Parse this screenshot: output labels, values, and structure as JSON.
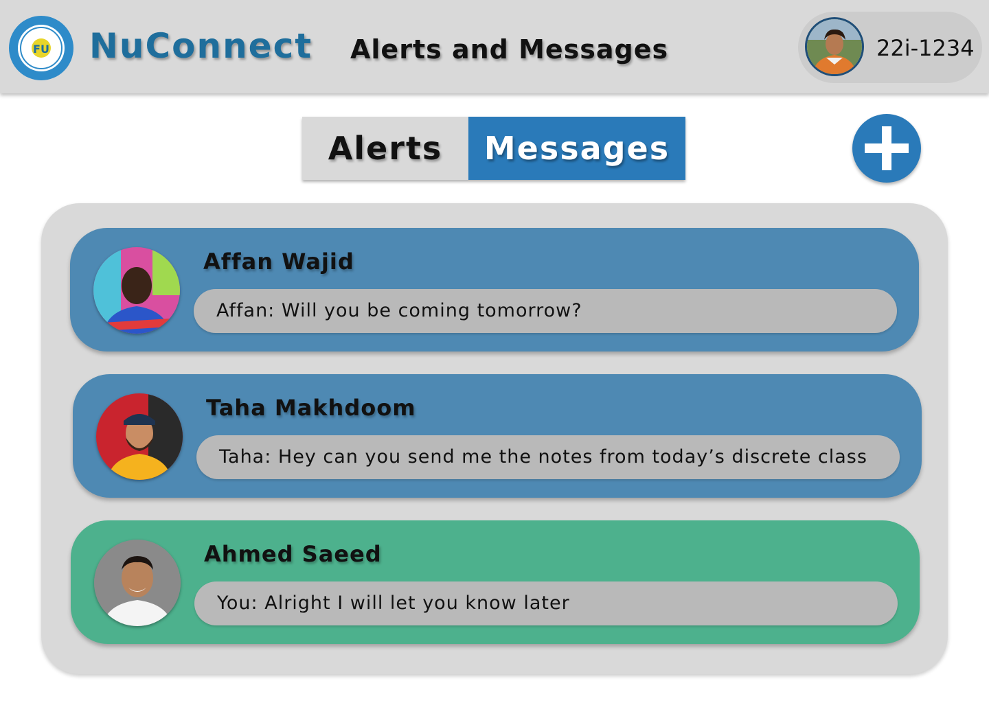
{
  "header": {
    "logo_icon": "nu-university-seal-logo",
    "app_name": "NuConnect",
    "page_title": "Alerts and Messages",
    "user": {
      "id": "22i-1234",
      "avatar_icon": "user-avatar-photo"
    }
  },
  "tabs": [
    {
      "label": "Alerts",
      "active": false
    },
    {
      "label": "Messages",
      "active": true
    }
  ],
  "add_button_icon": "plus-icon",
  "colors": {
    "brand": "#1f6e9c",
    "tab_active": "#2a7ab9",
    "card_blue": "#4e89b3",
    "card_green": "#4db18d",
    "panel": "#d9d9d9",
    "bubble": "#b9b9b9"
  },
  "conversations": [
    {
      "name": "Affan Wajid",
      "preview": "Affan: Will you be coming tomorrow?",
      "color": "blue",
      "avatar_icon": "contact-avatar-photo"
    },
    {
      "name": "Taha Makhdoom",
      "preview": "Taha: Hey can you send me the notes from today’s discrete class",
      "color": "blue",
      "avatar_icon": "contact-avatar-photo"
    },
    {
      "name": "Ahmed Saeed",
      "preview": "You: Alright I will let you know later",
      "color": "green",
      "avatar_icon": "contact-avatar-photo"
    }
  ]
}
